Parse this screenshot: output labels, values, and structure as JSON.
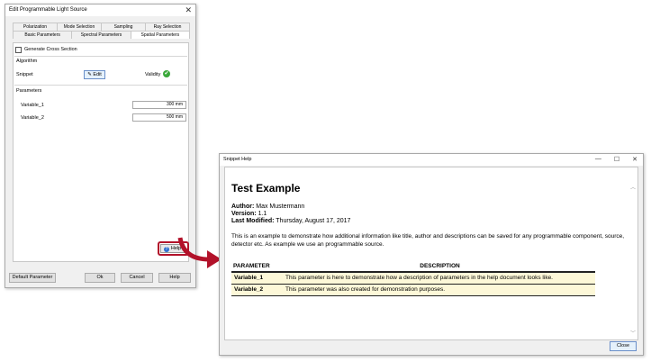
{
  "edit_dialog": {
    "title": "Edit Programmable Light Source",
    "close_glyph": "✕",
    "tabs_row1": [
      "Polarization",
      "Mode Selection",
      "Sampling",
      "Ray Selection"
    ],
    "tabs_row2": [
      "Basic Parameters",
      "Spectral Parameters",
      "Spatial Parameters"
    ],
    "active_tab": "Spatial Parameters",
    "generate_cross_section": {
      "label": "Generate Cross Section",
      "checked": false
    },
    "algorithm": {
      "section_label": "Algorithm",
      "snippet_label": "Snippet",
      "edit_button": "Edit",
      "edit_icon": "pencil-icon",
      "validity_label": "Validity",
      "validity_icon": "check-circle-icon",
      "validity_color": "#3aa83a"
    },
    "parameters": {
      "section_label": "Parameters",
      "rows": [
        {
          "name": "Variable_1",
          "value": "300 mm"
        },
        {
          "name": "Variable_2",
          "value": "500 mm"
        }
      ]
    },
    "help_button": "Help",
    "help_icon": "help-question-icon",
    "highlight_color": "#b2122a",
    "bottom_buttons": {
      "default": "Default Parameter",
      "ok": "Ok",
      "cancel": "Cancel",
      "help": "Help"
    }
  },
  "snippet_help": {
    "title": "Snippet Help",
    "window_buttons": [
      "—",
      "☐",
      "✕"
    ],
    "doc_title": "Test Example",
    "author_label": "Author:",
    "author": "Max Mustermann",
    "version_label": "Version:",
    "version": "1.1",
    "modified_label": "Last Modified:",
    "modified": "Thursday, August 17, 2017",
    "description": "This is an example to demonstrate how additional information like title, author and descriptions can be saved for any programmable component, source, detector etc. As example we use an programmable source.",
    "table_headers": [
      "PARAMETER",
      "DESCRIPTION"
    ],
    "table_rows": [
      {
        "name": "Variable_1",
        "desc": "This parameter is here to demonstrate how a description of parameters in the help document looks like."
      },
      {
        "name": "Variable_2",
        "desc": "This parameter was also created for demonstration purposes."
      }
    ],
    "row_color": "#fdf8d8",
    "close_button": "Close"
  },
  "arrow_color": "#b2122a"
}
